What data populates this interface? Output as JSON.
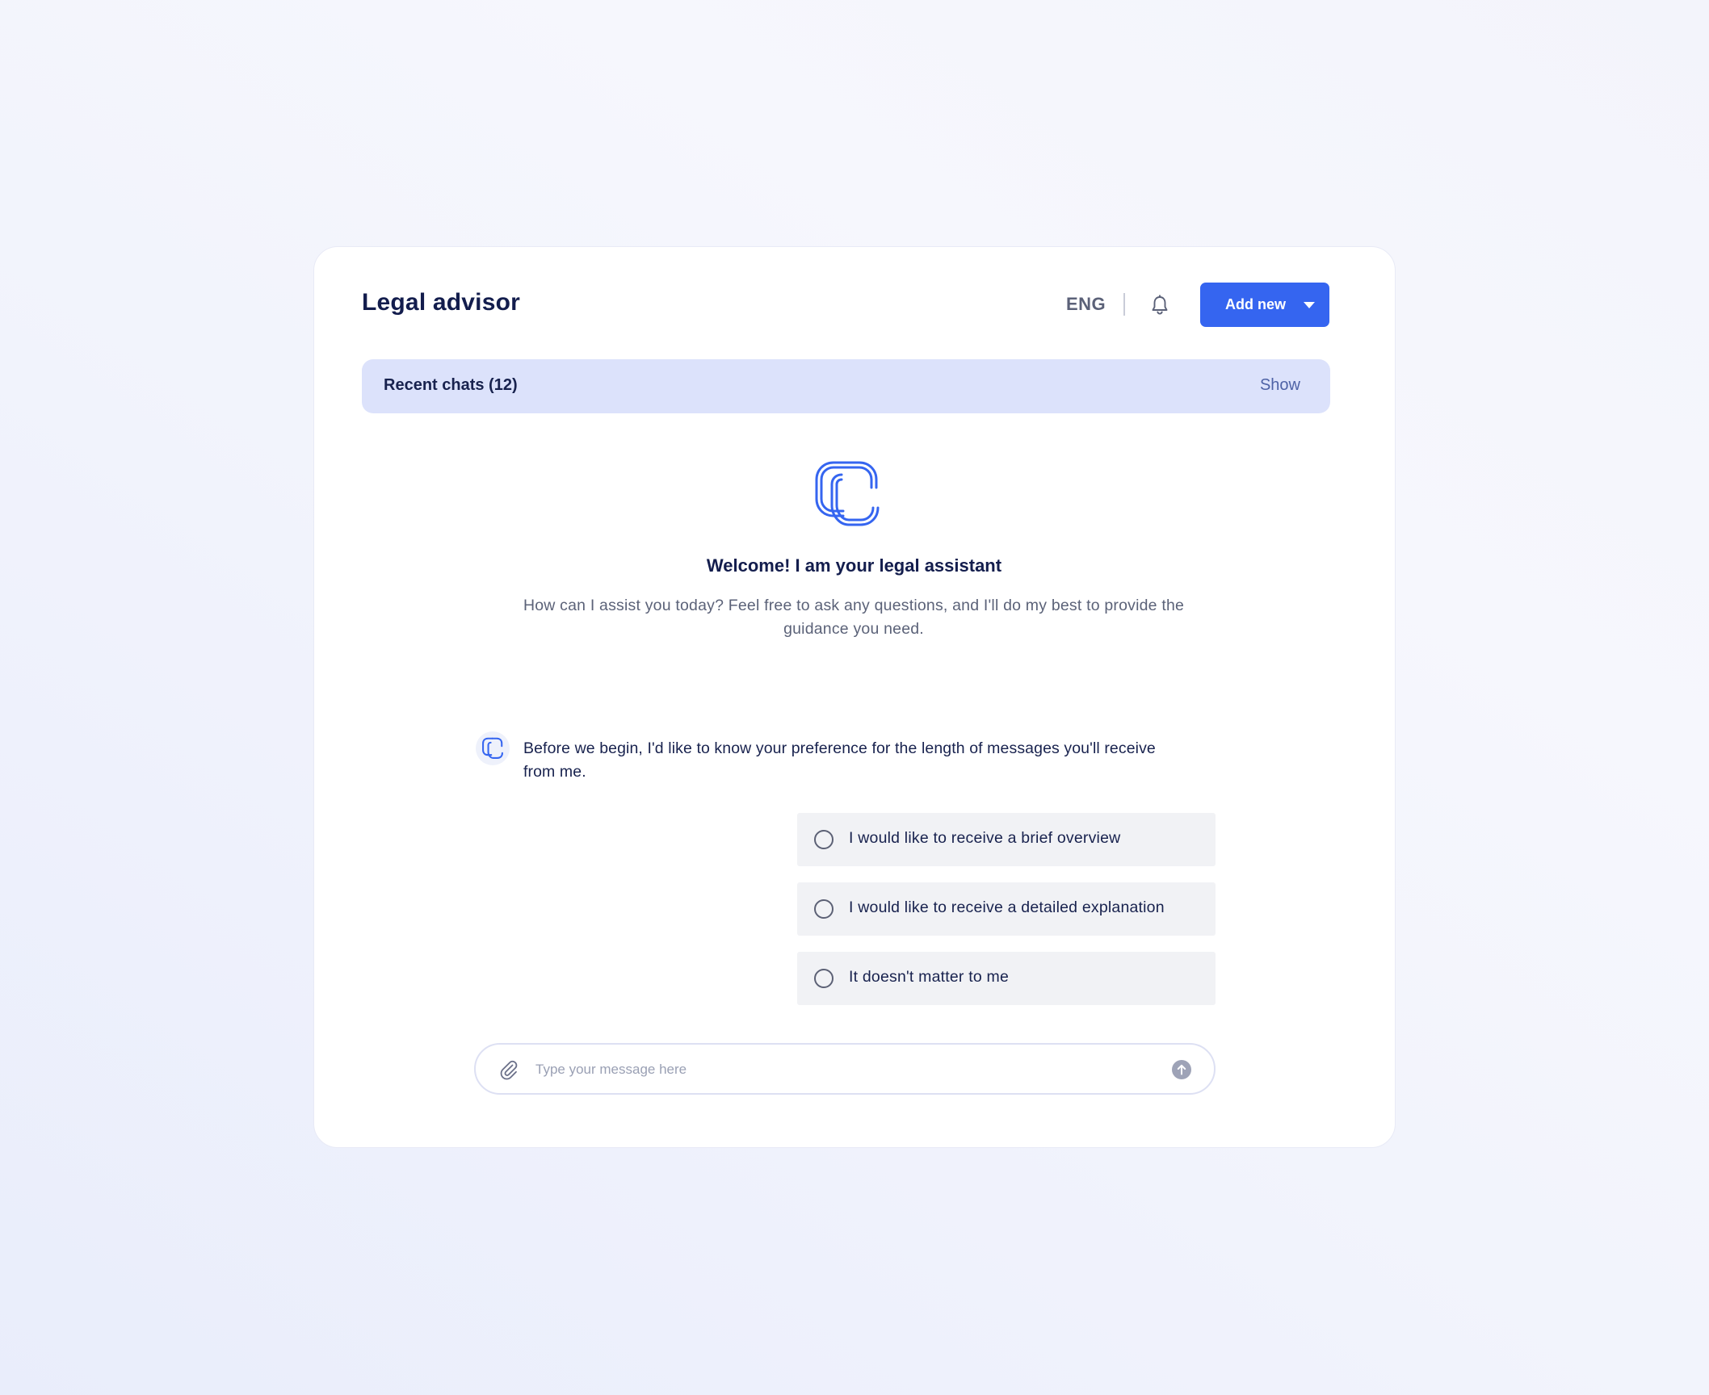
{
  "app": {
    "title": "Legal advisor"
  },
  "header": {
    "language": "ENG",
    "add_new_label": "Add new"
  },
  "recent_chats": {
    "label": "Recent chats (12)",
    "show_label": "Show"
  },
  "welcome": {
    "heading": "Welcome! I am your legal assistant",
    "subtitle": "How can I assist you today? Feel free to ask any questions, and I'll do my best to provide the guidance you need."
  },
  "chat": {
    "bot_message": "Before we begin, I'd like to know your preference for the length of messages you'll receive from me.",
    "options": [
      {
        "label": "I would like to receive a brief overview"
      },
      {
        "label": "I would like to receive a detailed explanation"
      },
      {
        "label": "It doesn't matter to me"
      }
    ]
  },
  "composer": {
    "placeholder": "Type your message here",
    "value": ""
  },
  "icons": {
    "bell": "bell-icon",
    "clip": "paperclip-icon",
    "send": "arrow-up-circle-icon",
    "logo": "c-logo-icon",
    "caret": "caret-down-icon"
  },
  "colors": {
    "primary": "#3565f0",
    "recent_bg": "#dce2fb",
    "title": "#131d4d",
    "muted": "#5b6278"
  }
}
